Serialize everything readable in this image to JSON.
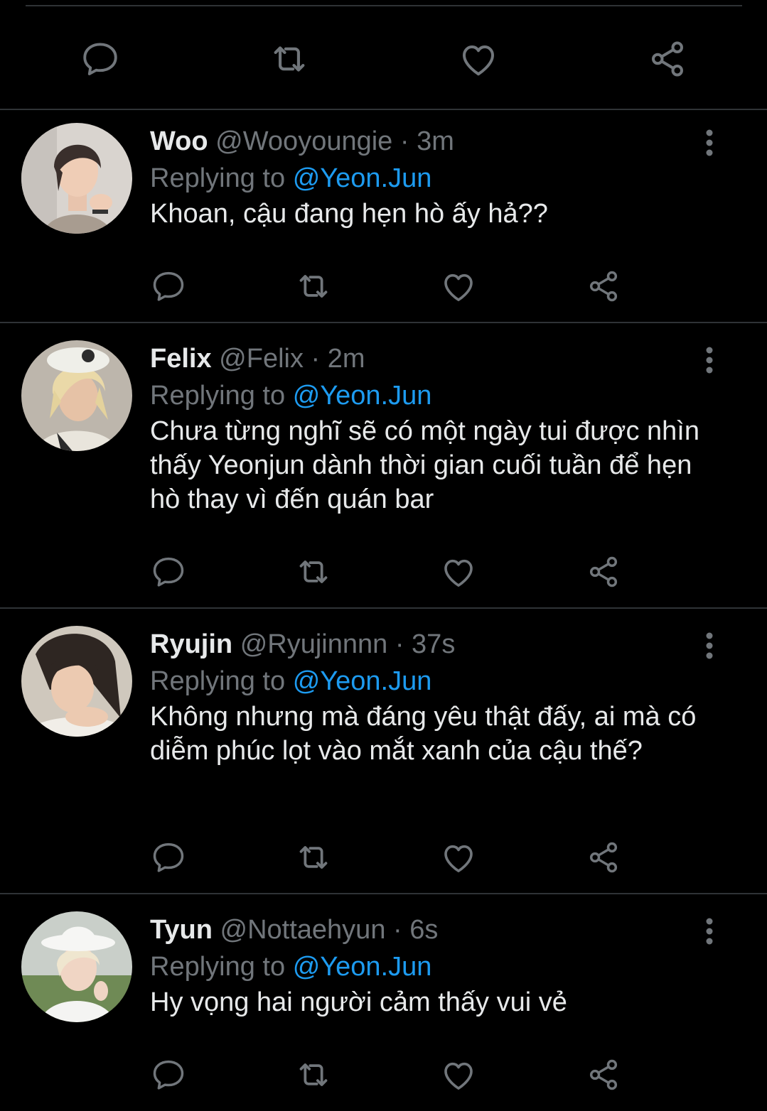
{
  "icons": {
    "reply": "reply-icon",
    "retweet": "retweet-icon",
    "like": "heart-icon",
    "share": "share-icon",
    "more": "more-vertical-icon"
  },
  "colors": {
    "background": "#000000",
    "text": "#e7e9ea",
    "secondary": "#71767b",
    "accent": "#1d9bf0",
    "divider": "#2f3336"
  },
  "replies": [
    {
      "name": "Woo",
      "handle": "@Wooyoungie",
      "separator": "·",
      "time": "3m",
      "replying_label": "Replying to",
      "replying_to": "@Yeon.Jun",
      "text": "Khoan, cậu đang hẹn hò ấy hả??"
    },
    {
      "name": "Felix",
      "handle": "@Felix",
      "separator": "·",
      "time": "2m",
      "replying_label": "Replying to",
      "replying_to": "@Yeon.Jun",
      "text": "Chưa từng nghĩ sẽ có một ngày tui được nhìn thấy Yeonjun dành thời gian cuối tuần để hẹn hò thay vì đến quán bar"
    },
    {
      "name": "Ryujin",
      "handle": "@Ryujinnnn",
      "separator": "·",
      "time": "37s",
      "replying_label": "Replying to",
      "replying_to": "@Yeon.Jun",
      "text": "Không nhưng mà đáng yêu thật đấy, ai mà có diễm phúc lọt vào mắt xanh của cậu thế?"
    },
    {
      "name": "Tyun",
      "handle": "@Nottaehyun",
      "separator": "·",
      "time": "6s",
      "replying_label": "Replying to",
      "replying_to": "@Yeon.Jun",
      "text": "Hy vọng hai người cảm thấy vui vẻ"
    }
  ]
}
